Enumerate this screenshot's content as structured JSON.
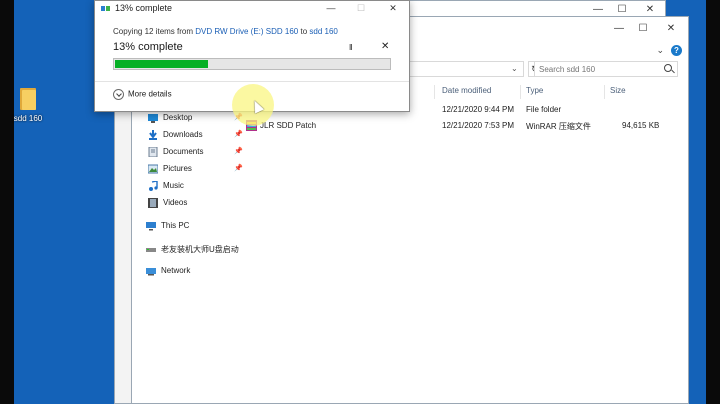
{
  "desktop": {
    "icon_label": "sdd 160"
  },
  "copy_dialog": {
    "title": "13% complete",
    "copy_prefix": "Copying 12 items from",
    "source": "DVD RW Drive (E:) SDD 160",
    "to_word": "to",
    "dest": "sdd 160",
    "percent_text": "13% complete",
    "progress_percent": 13,
    "pause_label": "II",
    "cancel_label": "✕",
    "more_details": "More details"
  },
  "explorer": {
    "search_placeholder": "Search sdd 160",
    "columns": {
      "date": "Date modified",
      "type": "Type",
      "size": "Size"
    },
    "nav": [
      {
        "label": "Desktop",
        "icon": "desktop-icon",
        "pinned": true
      },
      {
        "label": "Downloads",
        "icon": "download-icon",
        "pinned": true
      },
      {
        "label": "Documents",
        "icon": "documents-icon",
        "pinned": true
      },
      {
        "label": "Pictures",
        "icon": "pictures-icon",
        "pinned": true
      },
      {
        "label": "Music",
        "icon": "music-icon",
        "pinned": false
      },
      {
        "label": "Videos",
        "icon": "videos-icon",
        "pinned": false
      },
      {
        "label": "This PC",
        "icon": "pc-icon",
        "pinned": false
      },
      {
        "label": "老友装机大师U盘启动",
        "icon": "drive-icon",
        "pinned": false
      },
      {
        "label": "Network",
        "icon": "network-icon",
        "pinned": false
      }
    ],
    "files": [
      {
        "name": "",
        "date": "12/21/2020 9:44 PM",
        "type": "File folder",
        "size": ""
      },
      {
        "name": "JLR SDD Patch",
        "date": "12/21/2020 7:53 PM",
        "type": "WinRAR 压缩文件",
        "size": "94,615 KB"
      }
    ]
  },
  "colors": {
    "progress": "#06b025",
    "link": "#1b5fb5",
    "desktop": "#1462b8"
  }
}
